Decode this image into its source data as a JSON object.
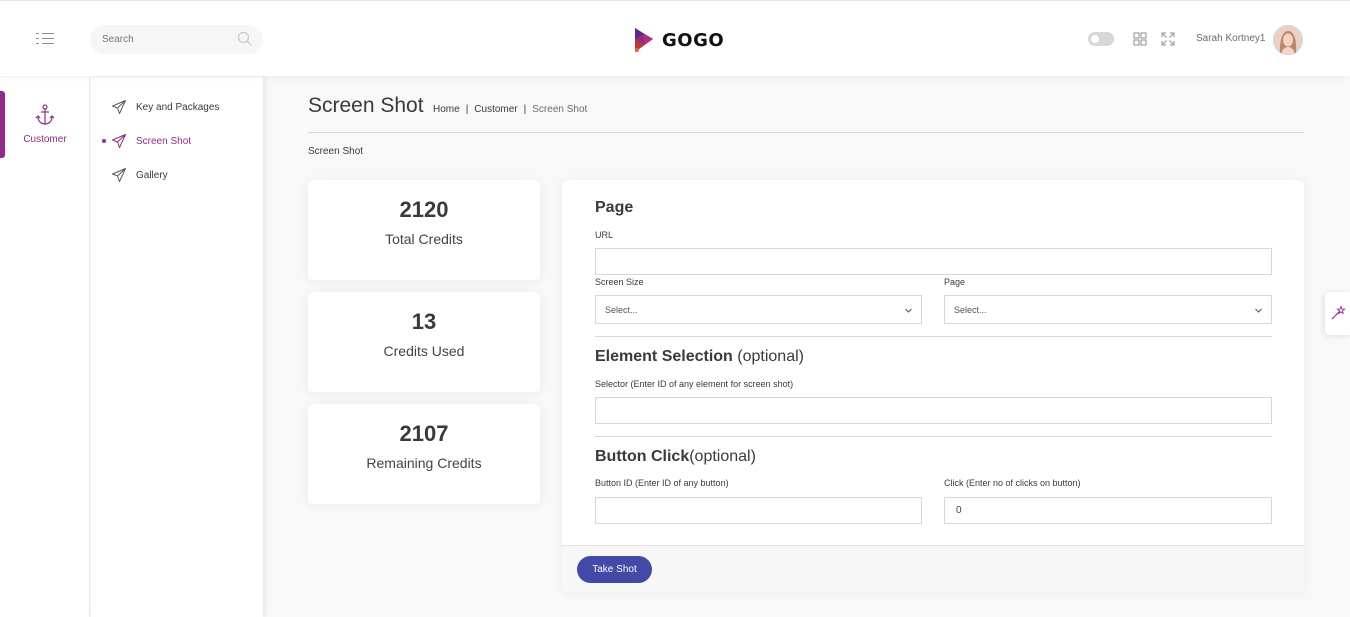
{
  "search": {
    "placeholder": "Search"
  },
  "brand": {
    "name": "GOGO"
  },
  "user": {
    "name": "Sarah Kortney1"
  },
  "main_menu": {
    "label": "Customer"
  },
  "sub_menu": {
    "items": [
      {
        "label": "Key and Packages"
      },
      {
        "label": "Screen Shot"
      },
      {
        "label": "Gallery"
      }
    ]
  },
  "page": {
    "title": "Screen Shot",
    "breadcrumb": [
      "Home",
      "Customer",
      "Screen Shot"
    ],
    "section_label": "Screen Shot"
  },
  "stats": [
    {
      "value": "2120",
      "label": "Total Credits"
    },
    {
      "value": "13",
      "label": "Credits Used"
    },
    {
      "value": "2107",
      "label": "Remaining Credits"
    }
  ],
  "form": {
    "page_heading": "Page",
    "url_label": "URL",
    "url_value": "",
    "screen_size_label": "Screen Size",
    "screen_size_value": "Select...",
    "page_select_label": "Page",
    "page_select_value": "Select...",
    "element_heading": "Element Selection",
    "element_heading_suffix": " (optional)",
    "selector_label": "Selector (Enter ID of any element for screen shot)",
    "selector_value": "",
    "button_heading": "Button Click",
    "button_heading_suffix": "(optional)",
    "button_id_label": "Button ID (Enter ID of any button)",
    "button_id_value": "",
    "clicks_label": "Click (Enter no of clicks on button)",
    "clicks_value": "0",
    "submit_label": "Take Shot"
  },
  "colors": {
    "accent": "#922c88",
    "button": "#4249a6",
    "background": "#f8f8f8"
  },
  "icons": {
    "menu": "menu-toggle-icon",
    "search": "search-icon",
    "logo": "gogo-logo-icon",
    "apps": "apps-grid-icon",
    "fullscreen": "fullscreen-icon",
    "customer": "anchor-icon",
    "subitem": "paper-plane-icon",
    "theme": "magic-wand-icon"
  }
}
